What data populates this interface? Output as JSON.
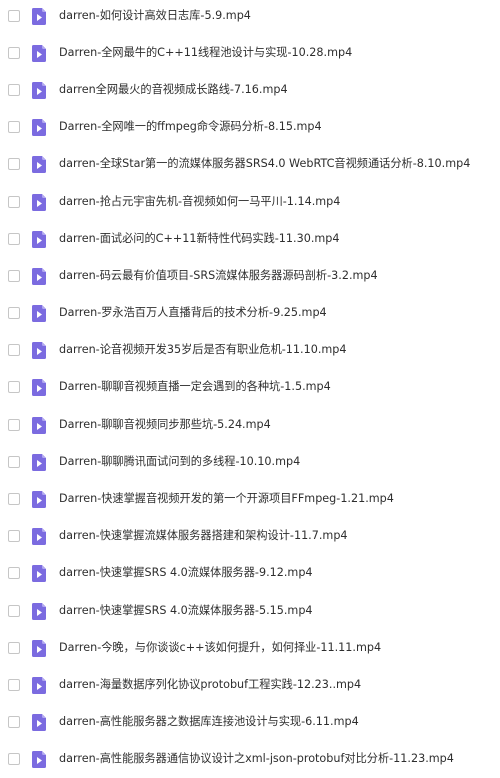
{
  "colors": {
    "icon_bg": "#7b6be0",
    "icon_fold": "#b2a8f0",
    "icon_play": "#ffffff",
    "text": "#2e2e2e",
    "checkbox_border": "#c6c6c6"
  },
  "files": [
    {
      "name": "darren-如何设计高效日志库-5.9.mp4",
      "icon": "video-file-icon"
    },
    {
      "name": "Darren-全网最牛的C++11线程池设计与实现-10.28.mp4",
      "icon": "video-file-icon"
    },
    {
      "name": "darren全网最火的音视频成长路线-7.16.mp4",
      "icon": "video-file-icon"
    },
    {
      "name": "Darren-全网唯一的ffmpeg命令源码分析-8.15.mp4",
      "icon": "video-file-icon"
    },
    {
      "name": "darren-全球Star第一的流媒体服务器SRS4.0 WebRTC音视频通话分析-8.10.mp4",
      "icon": "video-file-icon"
    },
    {
      "name": "darren-抢占元宇宙先机-音视频如何一马平川-1.14.mp4",
      "icon": "video-file-icon"
    },
    {
      "name": "darren-面试必问的C++11新特性代码实践-11.30.mp4",
      "icon": "video-file-icon"
    },
    {
      "name": "darren-码云最有价值项目-SRS流媒体服务器源码剖析-3.2.mp4",
      "icon": "video-file-icon"
    },
    {
      "name": "Darren-罗永浩百万人直播背后的技术分析-9.25.mp4",
      "icon": "video-file-icon"
    },
    {
      "name": "darren-论音视频开发35岁后是否有职业危机-11.10.mp4",
      "icon": "video-file-icon"
    },
    {
      "name": "Darren-聊聊音视频直播一定会遇到的各种坑-1.5.mp4",
      "icon": "video-file-icon"
    },
    {
      "name": "Darren-聊聊音视频同步那些坑-5.24.mp4",
      "icon": "video-file-icon"
    },
    {
      "name": "Darren-聊聊腾讯面试问到的多线程-10.10.mp4",
      "icon": "video-file-icon"
    },
    {
      "name": "Darren-快速掌握音视频开发的第一个开源项目FFmpeg-1.21.mp4",
      "icon": "video-file-icon"
    },
    {
      "name": "darren-快速掌握流媒体服务器搭建和架构设计-11.7.mp4",
      "icon": "video-file-icon"
    },
    {
      "name": "darren-快速掌握SRS 4.0流媒体服务器-9.12.mp4",
      "icon": "video-file-icon"
    },
    {
      "name": "darren-快速掌握SRS 4.0流媒体服务器-5.15.mp4",
      "icon": "video-file-icon"
    },
    {
      "name": "Darren-今晚，与你谈谈c++该如何提升，如何择业-11.11.mp4",
      "icon": "video-file-icon"
    },
    {
      "name": "darren-海量数据序列化协议protobuf工程实践-12.23..mp4",
      "icon": "video-file-icon"
    },
    {
      "name": "darren-高性能服务器之数据库连接池设计与实现-6.11.mp4",
      "icon": "video-file-icon"
    },
    {
      "name": "darren-高性能服务器通信协议设计之xml-json-protobuf对比分析-11.23.mp4",
      "icon": "video-file-icon"
    }
  ]
}
